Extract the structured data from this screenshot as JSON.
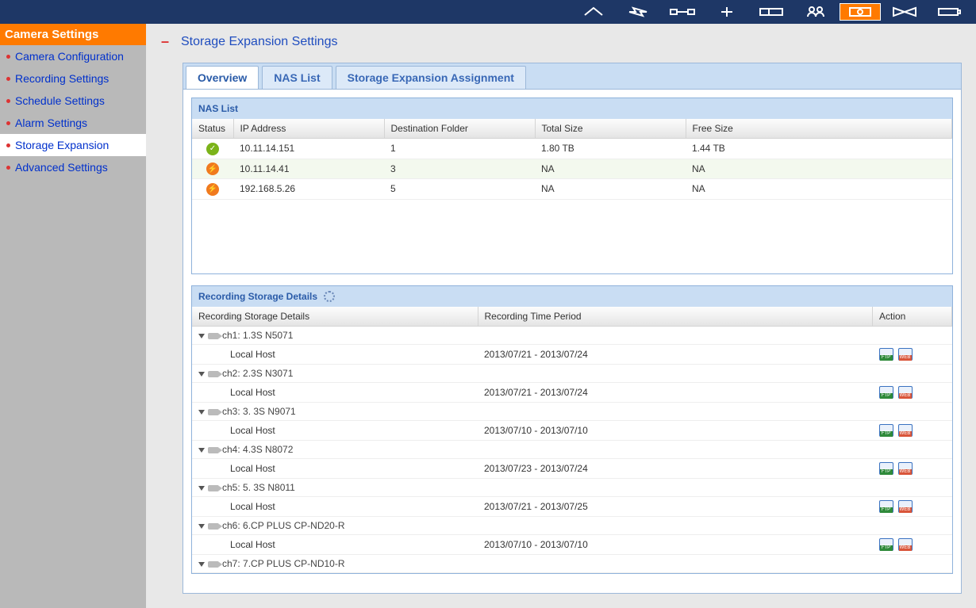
{
  "sidebar": {
    "header": "Camera Settings",
    "items": [
      {
        "label": "Camera Configuration",
        "active": false
      },
      {
        "label": "Recording Settings",
        "active": false
      },
      {
        "label": "Schedule Settings",
        "active": false
      },
      {
        "label": "Alarm Settings",
        "active": false
      },
      {
        "label": "Storage Expansion",
        "active": true
      },
      {
        "label": "Advanced Settings",
        "active": false
      }
    ]
  },
  "page": {
    "title": "Storage Expansion Settings",
    "collapse_symbol": "–"
  },
  "tabs": [
    {
      "label": "Overview",
      "active": true
    },
    {
      "label": "NAS List",
      "active": false
    },
    {
      "label": "Storage Expansion Assignment",
      "active": false
    }
  ],
  "nas_panel": {
    "title": "NAS List",
    "columns": {
      "status": "Status",
      "ip": "IP Address",
      "folder": "Destination Folder",
      "total": "Total Size",
      "free": "Free Size"
    },
    "rows": [
      {
        "status": "ok",
        "ip": "10.11.14.151",
        "folder": "1",
        "total": "1.80 TB",
        "free": "1.44 TB"
      },
      {
        "status": "warn",
        "ip": "10.11.14.41",
        "folder": "3",
        "total": "NA",
        "free": "NA"
      },
      {
        "status": "warn",
        "ip": "192.168.5.26",
        "folder": "5",
        "total": "NA",
        "free": "NA"
      }
    ]
  },
  "storage_panel": {
    "title": "Recording Storage Details",
    "columns": {
      "details": "Recording Storage Details",
      "period": "Recording Time Period",
      "action": "Action"
    },
    "local_host_label": "Local Host",
    "channels": [
      {
        "name": "ch1: 1.3S N5071",
        "period": "2013/07/21 - 2013/07/24"
      },
      {
        "name": "ch2: 2.3S N3071",
        "period": "2013/07/21 - 2013/07/24"
      },
      {
        "name": "ch3: 3. 3S N9071",
        "period": "2013/07/10 - 2013/07/10"
      },
      {
        "name": "ch4: 4.3S N8072",
        "period": "2013/07/23 - 2013/07/24"
      },
      {
        "name": "ch5: 5. 3S N8011",
        "period": "2013/07/21 - 2013/07/25"
      },
      {
        "name": "ch6: 6.CP PLUS CP-ND20-R",
        "period": "2013/07/10 - 2013/07/10"
      },
      {
        "name": "ch7: 7.CP PLUS CP-ND10-R",
        "period": ""
      }
    ]
  },
  "topbar_icons": [
    {
      "name": "home-icon",
      "active": false
    },
    {
      "name": "bolt-icon",
      "active": false
    },
    {
      "name": "link-icon",
      "active": false
    },
    {
      "name": "plus-icon",
      "active": false
    },
    {
      "name": "drive-icon",
      "active": false
    },
    {
      "name": "users-icon",
      "active": false
    },
    {
      "name": "camera-icon",
      "active": true
    },
    {
      "name": "bowtie-icon",
      "active": false
    },
    {
      "name": "battery-icon",
      "active": false
    }
  ]
}
